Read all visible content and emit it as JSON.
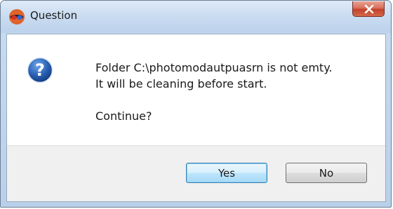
{
  "window": {
    "title": "Question",
    "app_icon": "3d-glasses-icon",
    "close_icon": "close-icon"
  },
  "message": {
    "icon": "question-icon",
    "line1": "Folder C:\\photomodautpuasrn is not emty.",
    "line2": "It will be cleaning before start.",
    "line3": "Continue?"
  },
  "buttons": {
    "yes_label": "Yes",
    "no_label": "No"
  },
  "colors": {
    "accent": "#3c7fb1",
    "close_button": "#c3402b",
    "question_icon": "#2a61b4"
  }
}
